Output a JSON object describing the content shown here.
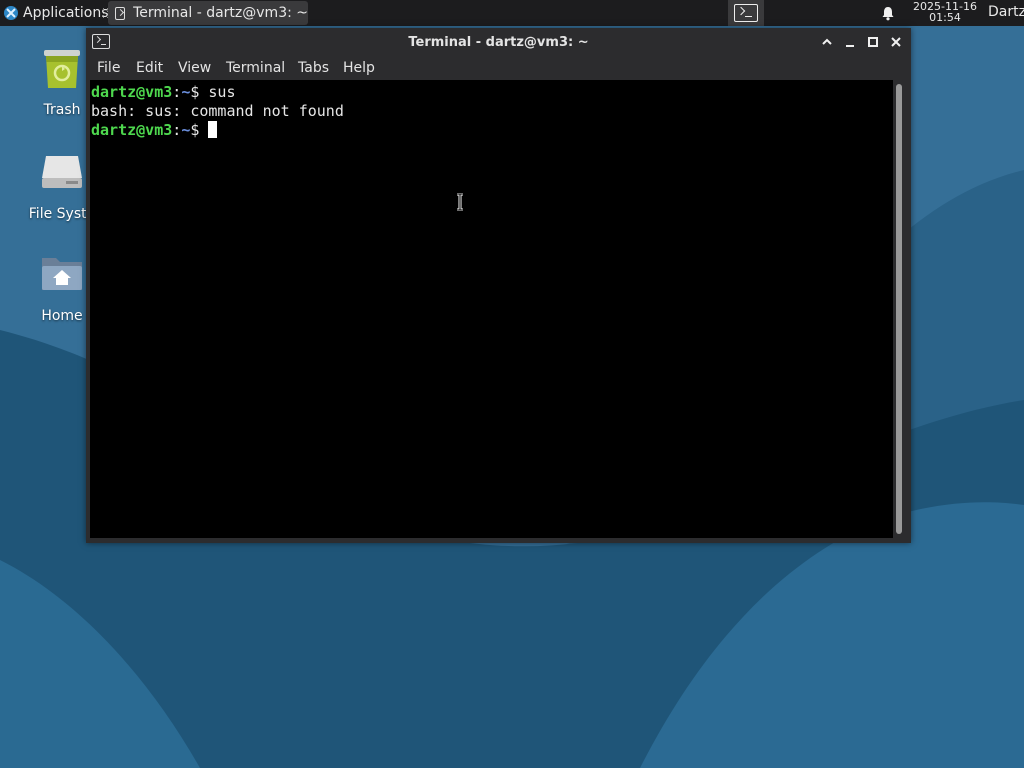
{
  "panel": {
    "applications_label": "Applications",
    "task_title": "Terminal - dartz@vm3: ~",
    "clock_date": "2025-11-16",
    "clock_time": "01:54",
    "user": "Dartz",
    "icons": [
      "xfce-logo-icon",
      "terminal-icon",
      "terminal-launcher-icon",
      "bell-icon"
    ]
  },
  "desktop": {
    "icons": [
      {
        "label": "Trash",
        "icon": "trash-icon"
      },
      {
        "label": "File Syste",
        "icon": "drive-icon"
      },
      {
        "label": "Home",
        "icon": "home-folder-icon"
      }
    ]
  },
  "window": {
    "title": "Terminal - dartz@vm3: ~",
    "buttons": {
      "maximize_up": "^",
      "minimize": "_",
      "maximize": "□",
      "close": "✕"
    },
    "menu": [
      "File",
      "Edit",
      "View",
      "Terminal",
      "Tabs",
      "Help"
    ]
  },
  "terminal": {
    "line1": {
      "user": "dartz@vm3",
      "sep": ":",
      "path": "~",
      "dollar": "$ ",
      "cmd": "sus"
    },
    "line2": "bash: sus: command not found",
    "line3": {
      "user": "dartz@vm3",
      "sep": ":",
      "path": "~",
      "dollar": "$ "
    }
  },
  "colors": {
    "wallpaper_light": "#2f6f99",
    "wallpaper_dark": "#1f4f73",
    "prompt_user": "#4ed84e",
    "prompt_path": "#6b8fdd"
  }
}
